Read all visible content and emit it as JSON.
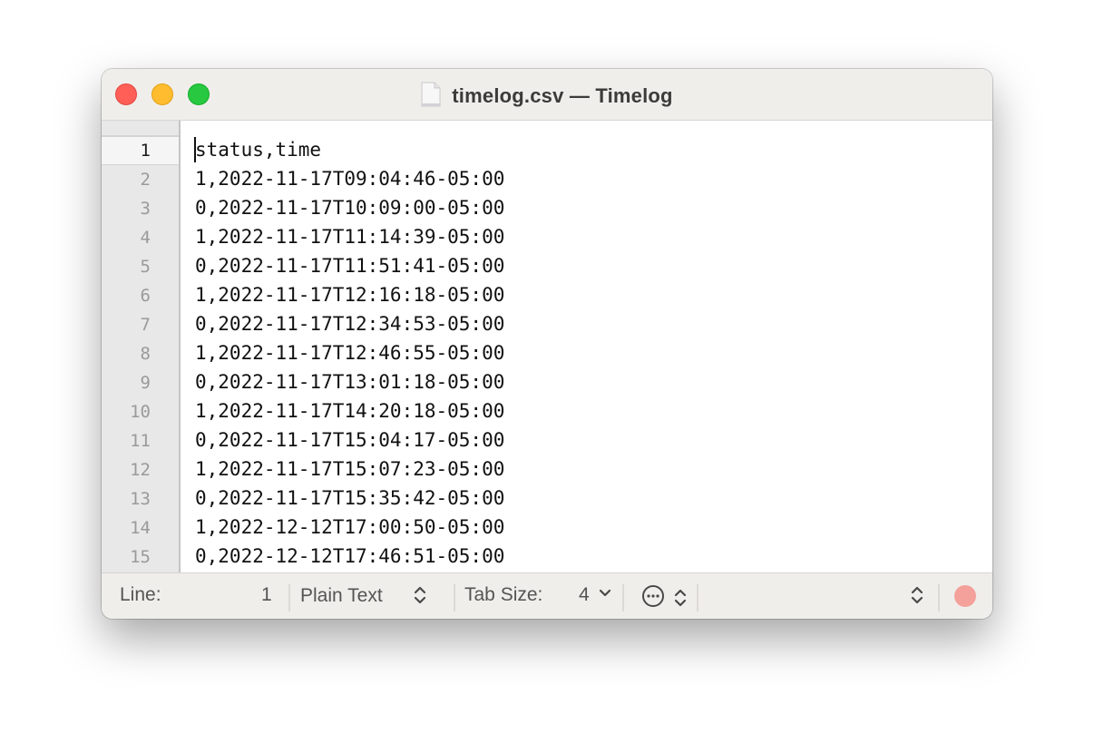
{
  "window": {
    "title": "timelog.csv — Timelog",
    "file_icon": "document-icon"
  },
  "editor": {
    "current_line": 1,
    "line_numbers": [
      "1",
      "2",
      "3",
      "4",
      "5",
      "6",
      "7",
      "8",
      "9",
      "10",
      "11",
      "12",
      "13",
      "14",
      "15"
    ],
    "lines": [
      "status,time",
      "1,2022-11-17T09:04:46-05:00",
      "0,2022-11-17T10:09:00-05:00",
      "1,2022-11-17T11:14:39-05:00",
      "0,2022-11-17T11:51:41-05:00",
      "1,2022-11-17T12:16:18-05:00",
      "0,2022-11-17T12:34:53-05:00",
      "1,2022-11-17T12:46:55-05:00",
      "0,2022-11-17T13:01:18-05:00",
      "1,2022-11-17T14:20:18-05:00",
      "0,2022-11-17T15:04:17-05:00",
      "1,2022-11-17T15:07:23-05:00",
      "0,2022-11-17T15:35:42-05:00",
      "1,2022-12-12T17:00:50-05:00",
      "0,2022-12-12T17:46:51-05:00"
    ]
  },
  "statusbar": {
    "line_label": "Line:",
    "line_value": "1",
    "syntax": "Plain Text",
    "tab_size_label": "Tab Size:",
    "tab_size_value": "4",
    "more_icon": "ellipsis-circle-icon",
    "record_color": "#f4a19b"
  },
  "colors": {
    "close": "#ff5f57",
    "minimize": "#febc2e",
    "maximize": "#28c840"
  }
}
